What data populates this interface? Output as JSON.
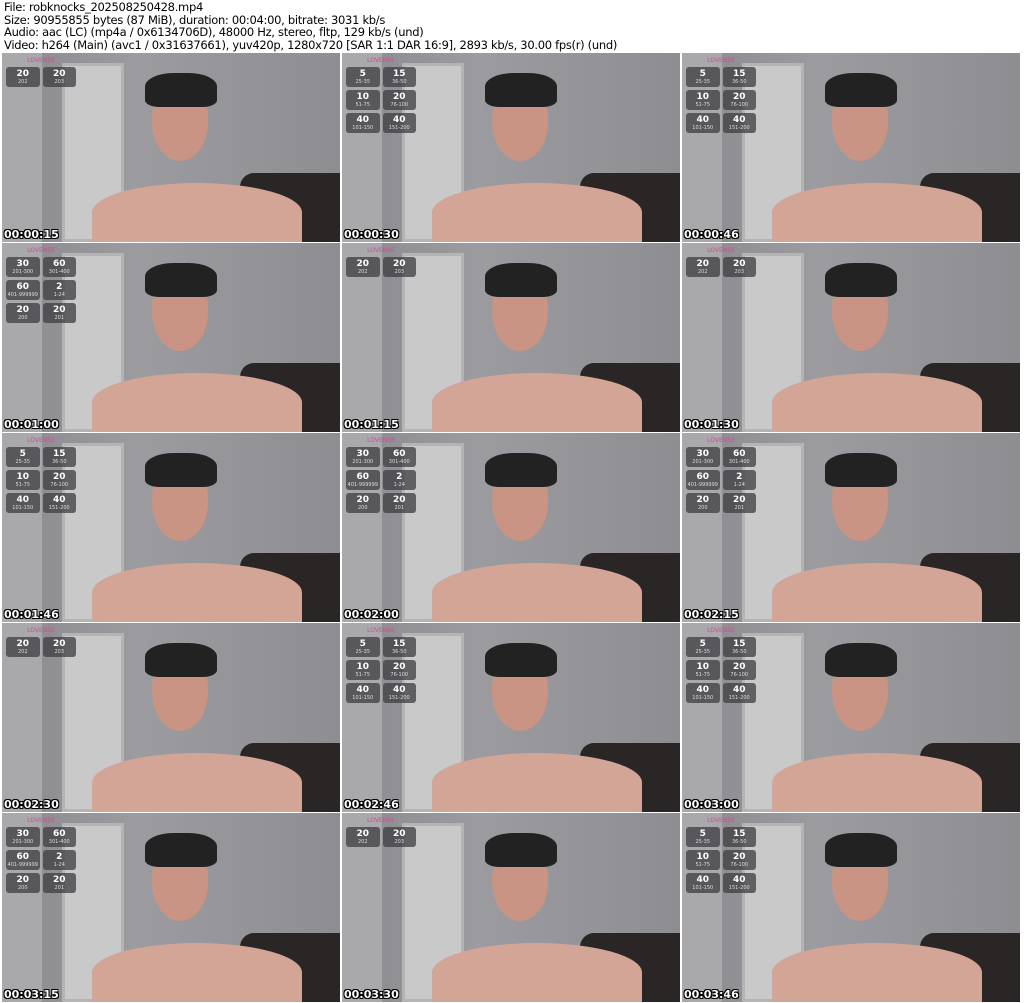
{
  "header": {
    "file": "File: robknocks_202508250428.mp4",
    "size": "Size: 90955855 bytes (87 MiB), duration: 00:04:00, bitrate: 3031 kb/s",
    "audio": "Audio: aac (LC) (mp4a / 0x6134706D), 48000 Hz, stereo, fltp, 129 kb/s (und)",
    "video": "Video: h264 (Main) (avc1 / 0x31637661), yuv420p, 1280x720 [SAR 1:1 DAR 16:9], 2893 kb/s, 30.00 fps(r) (und)"
  },
  "overlay_logo": "LOVENSE",
  "overlays": {
    "A": [
      {
        "v": "20",
        "r": "202"
      },
      {
        "v": "20",
        "r": "203"
      }
    ],
    "B": [
      {
        "v": "5",
        "r": "25-35"
      },
      {
        "v": "15",
        "r": "36-50"
      },
      {
        "v": "10",
        "r": "51-75"
      },
      {
        "v": "20",
        "r": "76-100"
      },
      {
        "v": "40",
        "r": "101-150"
      },
      {
        "v": "40",
        "r": "151-200"
      }
    ],
    "C": [
      {
        "v": "30",
        "r": "201-300"
      },
      {
        "v": "60",
        "r": "301-400"
      },
      {
        "v": "60",
        "r": "401-999999"
      },
      {
        "v": "2",
        "r": "1-24"
      },
      {
        "v": "20",
        "r": "200"
      },
      {
        "v": "20",
        "r": "201"
      }
    ]
  },
  "frames": [
    {
      "time": "00:00:15",
      "overlay": "A"
    },
    {
      "time": "00:00:30",
      "overlay": "B"
    },
    {
      "time": "00:00:46",
      "overlay": "B"
    },
    {
      "time": "00:01:00",
      "overlay": "C"
    },
    {
      "time": "00:01:15",
      "overlay": "A"
    },
    {
      "time": "00:01:30",
      "overlay": "A"
    },
    {
      "time": "00:01:46",
      "overlay": "B"
    },
    {
      "time": "00:02:00",
      "overlay": "C"
    },
    {
      "time": "00:02:15",
      "overlay": "C"
    },
    {
      "time": "00:02:30",
      "overlay": "A"
    },
    {
      "time": "00:02:46",
      "overlay": "B"
    },
    {
      "time": "00:03:00",
      "overlay": "B"
    },
    {
      "time": "00:03:15",
      "overlay": "C"
    },
    {
      "time": "00:03:30",
      "overlay": "A"
    },
    {
      "time": "00:03:46",
      "overlay": "B"
    }
  ]
}
